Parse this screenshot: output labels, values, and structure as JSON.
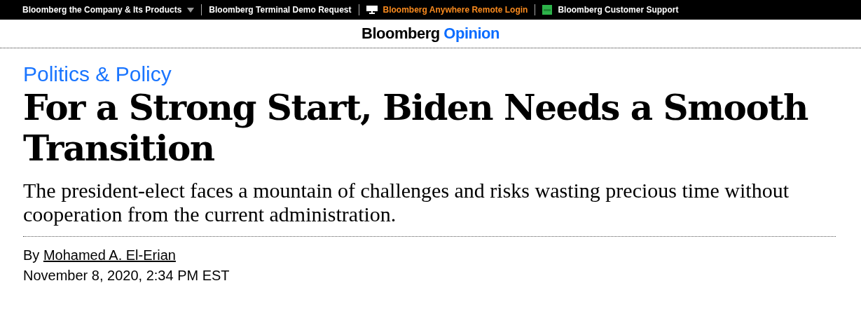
{
  "top_bar": {
    "links": [
      {
        "label": "Bloomberg the Company & Its Products",
        "kind": "dropdown"
      },
      {
        "label": "Bloomberg Terminal Demo Request",
        "kind": "plain"
      },
      {
        "label": "Bloomberg Anywhere Remote Login",
        "kind": "terminal"
      },
      {
        "label": "Bloomberg Customer Support",
        "kind": "help"
      }
    ]
  },
  "logo": {
    "brand": "Bloomberg",
    "section": "Opinion"
  },
  "article": {
    "category": "Politics & Policy",
    "headline": "For a Strong Start, Biden Needs a Smooth Transition",
    "dek": "The president-elect faces a mountain of challenges and risks wasting precious time without cooperation from the current administration.",
    "byline_prefix": "By",
    "author": "Mohamed A. El-Erian",
    "date": "November 8, 2020, 2:34 PM EST"
  }
}
